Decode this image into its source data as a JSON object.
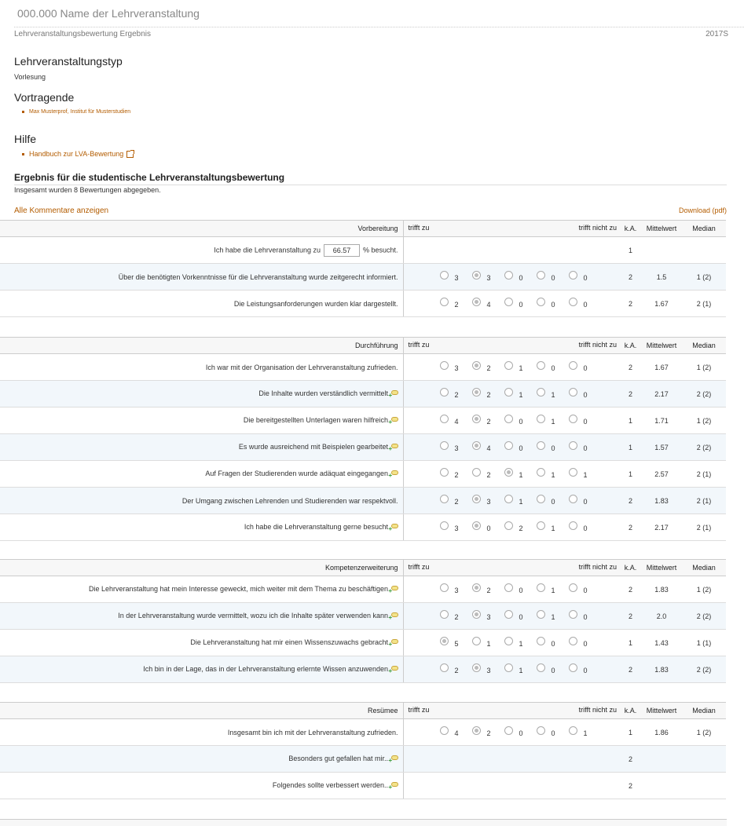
{
  "page": {
    "title": "000.000 Name der Lehrveranstaltung",
    "subheader_left": "Lehrveranstaltungsbewertung Ergebnis",
    "subheader_right": "2017S"
  },
  "info": {
    "type_heading": "Lehrveranstaltungstyp",
    "type_value": "Vorlesung",
    "lecturers_heading": "Vortragende",
    "lecturer": "Max Musterprof, Institut für Musterstudien",
    "help_heading": "Hilfe",
    "help_link": "Handbuch zur LVA-Bewertung"
  },
  "result": {
    "title": "Ergebnis für die studentische Lehrveranstaltungsbewertung",
    "subtitle": "Insgesamt wurden 8 Bewertungen abgegeben.",
    "all_comments": "Alle Kommentare anzeigen",
    "download": "Download (pdf)"
  },
  "columns": {
    "applies": "trifft zu",
    "not_applies": "trifft nicht zu",
    "ka": "k.A.",
    "mean": "Mittelwert",
    "median": "Median"
  },
  "sections": [
    {
      "name": "Vorbereitung",
      "rows": [
        {
          "q_pre": "Ich habe die Lehrveranstaltung zu",
          "input": "66.57",
          "q_post": "% besucht.",
          "ka": "1",
          "mean": "",
          "median": ""
        },
        {
          "q": "Über die benötigten Vorkenntnisse für die Lehrveranstaltung wurde zeitgerecht informiert.",
          "counts": [
            "3",
            "3",
            "0",
            "0",
            "0"
          ],
          "checked": 1,
          "ka": "2",
          "mean": "1.5",
          "median": "1 (2)",
          "comment": false
        },
        {
          "q": "Die Leistungsanforderungen wurden klar dargestellt.",
          "counts": [
            "2",
            "4",
            "0",
            "0",
            "0"
          ],
          "checked": 1,
          "ka": "2",
          "mean": "1.67",
          "median": "2 (1)",
          "comment": false
        }
      ]
    },
    {
      "name": "Durchführung",
      "rows": [
        {
          "q": "Ich war mit der Organisation der Lehrveranstaltung zufrieden.",
          "counts": [
            "3",
            "2",
            "1",
            "0",
            "0"
          ],
          "checked": 1,
          "ka": "2",
          "mean": "1.67",
          "median": "1 (2)",
          "comment": false
        },
        {
          "q": "Die Inhalte wurden verständlich vermittelt.",
          "counts": [
            "2",
            "2",
            "1",
            "1",
            "0"
          ],
          "checked": 1,
          "ka": "2",
          "mean": "2.17",
          "median": "2 (2)",
          "comment": true
        },
        {
          "q": "Die bereitgestellten Unterlagen waren hilfreich.",
          "counts": [
            "4",
            "2",
            "0",
            "1",
            "0"
          ],
          "checked": 1,
          "ka": "1",
          "mean": "1.71",
          "median": "1 (2)",
          "comment": true
        },
        {
          "q": "Es wurde ausreichend mit Beispielen gearbeitet.",
          "counts": [
            "3",
            "4",
            "0",
            "0",
            "0"
          ],
          "checked": 1,
          "ka": "1",
          "mean": "1.57",
          "median": "2 (2)",
          "comment": true
        },
        {
          "q": "Auf Fragen der Studierenden wurde adäquat eingegangen.",
          "counts": [
            "2",
            "2",
            "1",
            "1",
            "1"
          ],
          "checked": 2,
          "ka": "1",
          "mean": "2.57",
          "median": "2 (1)",
          "comment": true
        },
        {
          "q": "Der Umgang zwischen Lehrenden und Studierenden war respektvoll.",
          "counts": [
            "2",
            "3",
            "1",
            "0",
            "0"
          ],
          "checked": 1,
          "ka": "2",
          "mean": "1.83",
          "median": "2 (1)",
          "comment": false
        },
        {
          "q": "Ich habe die Lehrveranstaltung gerne besucht.",
          "counts": [
            "3",
            "0",
            "2",
            "1",
            "0"
          ],
          "checked": 1,
          "ka": "2",
          "mean": "2.17",
          "median": "2 (1)",
          "comment": true
        }
      ]
    },
    {
      "name": "Kompetenzerweiterung",
      "rows": [
        {
          "q": "Die Lehrveranstaltung hat mein Interesse geweckt, mich weiter mit dem Thema zu beschäftigen.",
          "counts": [
            "3",
            "2",
            "0",
            "1",
            "0"
          ],
          "checked": 1,
          "ka": "2",
          "mean": "1.83",
          "median": "1 (2)",
          "comment": true
        },
        {
          "q": "In der Lehrveranstaltung wurde vermittelt, wozu ich die Inhalte später verwenden kann.",
          "counts": [
            "2",
            "3",
            "0",
            "1",
            "0"
          ],
          "checked": 1,
          "ka": "2",
          "mean": "2.0",
          "median": "2 (2)",
          "comment": true
        },
        {
          "q": "Die Lehrveranstaltung hat mir einen Wissenszuwachs gebracht.",
          "counts": [
            "5",
            "1",
            "1",
            "0",
            "0"
          ],
          "checked": 0,
          "ka": "1",
          "mean": "1.43",
          "median": "1 (1)",
          "comment": true
        },
        {
          "q": "Ich bin in der Lage, das in der Lehrveranstaltung erlernte Wissen anzuwenden.",
          "counts": [
            "2",
            "3",
            "1",
            "0",
            "0"
          ],
          "checked": 1,
          "ka": "2",
          "mean": "1.83",
          "median": "2 (2)",
          "comment": true
        }
      ]
    },
    {
      "name": "Resümee",
      "rows": [
        {
          "q": "Insgesamt bin ich mit der Lehrveranstaltung zufrieden.",
          "counts": [
            "4",
            "2",
            "0",
            "0",
            "1"
          ],
          "checked": 1,
          "ka": "1",
          "mean": "1.86",
          "median": "1 (2)",
          "comment": false
        },
        {
          "q": "Besonders gut gefallen hat mir...",
          "counts": null,
          "ka": "2",
          "mean": "",
          "median": "",
          "comment": true
        },
        {
          "q": "Folgendes sollte verbessert werden...",
          "counts": null,
          "ka": "2",
          "mean": "",
          "median": "",
          "comment": true
        }
      ]
    }
  ]
}
